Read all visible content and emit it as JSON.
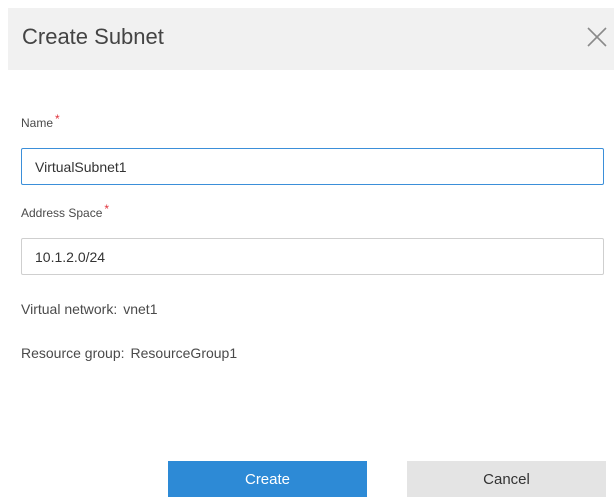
{
  "dialog": {
    "title": "Create Subnet",
    "close_icon": "close-icon"
  },
  "form": {
    "name": {
      "label": "Name",
      "required_mark": "*",
      "value": "VirtualSubnet1"
    },
    "address_space": {
      "label": "Address Space",
      "required_mark": "*",
      "value": "10.1.2.0/24"
    }
  },
  "info": {
    "virtual_network_label": "Virtual network:",
    "virtual_network_value": "vnet1",
    "resource_group_label": "Resource group:",
    "resource_group_value": "ResourceGroup1"
  },
  "actions": {
    "create_label": "Create",
    "cancel_label": "Cancel"
  },
  "colors": {
    "primary": "#2d8ad6",
    "required": "#e0323c",
    "focus_border": "#3b8fd9",
    "header_bg": "#f1f1f1",
    "secondary_bg": "#e4e4e4"
  }
}
